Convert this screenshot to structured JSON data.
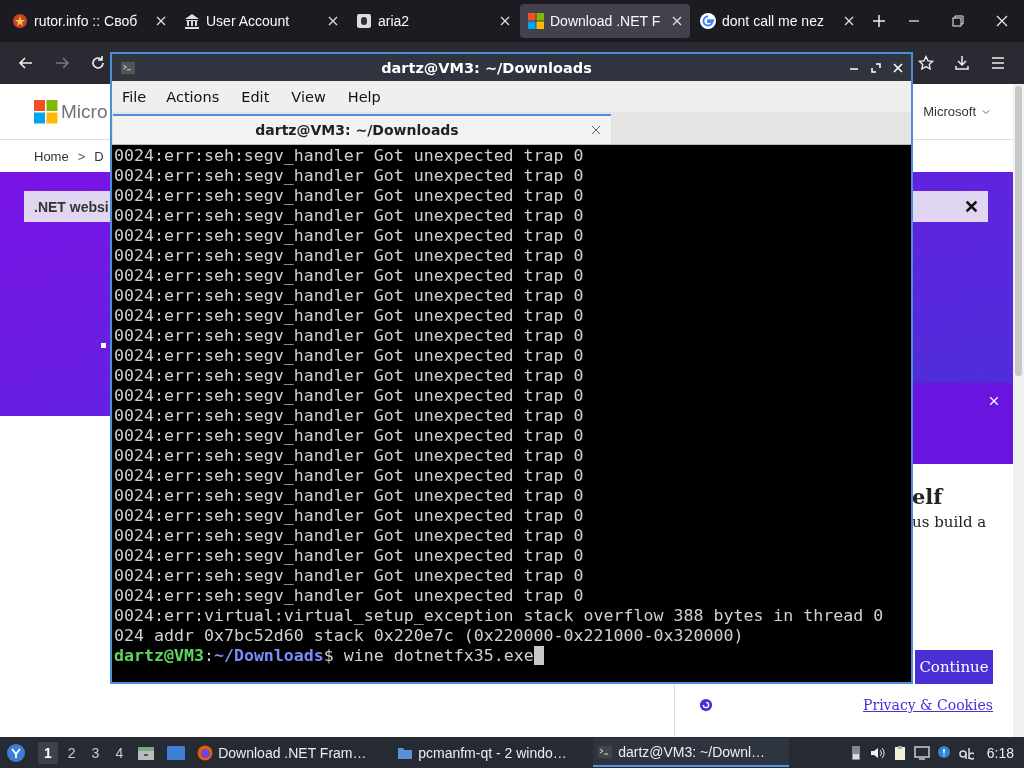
{
  "browser": {
    "tabs": [
      {
        "label": "rutor.info :: Своб",
        "selected": false
      },
      {
        "label": "User Account",
        "selected": false
      },
      {
        "label": "aria2",
        "selected": false
      },
      {
        "label": "Download .NET F",
        "selected": true
      },
      {
        "label": "dont call me nez",
        "selected": false
      }
    ],
    "page": {
      "logo_text": "Micro",
      "account": "Microsoft",
      "breadcrumb": [
        "Home",
        ">",
        "D"
      ],
      "notice": ".NET websi",
      "dialog": {
        "heading": "elf",
        "text": "us build a",
        "button": "Continue",
        "link": "Privacy & Cookies"
      }
    }
  },
  "terminal": {
    "title": "dartz@VM3: ~/Downloads",
    "menu": [
      "File",
      "Actions",
      "Edit",
      "View",
      "Help"
    ],
    "tab": "dartz@VM3: ~/Downloads",
    "lines": [
      "0024:err:seh:segv_handler Got unexpected trap 0",
      "0024:err:seh:segv_handler Got unexpected trap 0",
      "0024:err:seh:segv_handler Got unexpected trap 0",
      "0024:err:seh:segv_handler Got unexpected trap 0",
      "0024:err:seh:segv_handler Got unexpected trap 0",
      "0024:err:seh:segv_handler Got unexpected trap 0",
      "0024:err:seh:segv_handler Got unexpected trap 0",
      "0024:err:seh:segv_handler Got unexpected trap 0",
      "0024:err:seh:segv_handler Got unexpected trap 0",
      "0024:err:seh:segv_handler Got unexpected trap 0",
      "0024:err:seh:segv_handler Got unexpected trap 0",
      "0024:err:seh:segv_handler Got unexpected trap 0",
      "0024:err:seh:segv_handler Got unexpected trap 0",
      "0024:err:seh:segv_handler Got unexpected trap 0",
      "0024:err:seh:segv_handler Got unexpected trap 0",
      "0024:err:seh:segv_handler Got unexpected trap 0",
      "0024:err:seh:segv_handler Got unexpected trap 0",
      "0024:err:seh:segv_handler Got unexpected trap 0",
      "0024:err:seh:segv_handler Got unexpected trap 0",
      "0024:err:seh:segv_handler Got unexpected trap 0",
      "0024:err:seh:segv_handler Got unexpected trap 0",
      "0024:err:seh:segv_handler Got unexpected trap 0",
      "0024:err:seh:segv_handler Got unexpected trap 0",
      "0024:err:virtual:virtual_setup_exception stack overflow 388 bytes in thread 0",
      "024 addr 0x7bc52d60 stack 0x220e7c (0x220000-0x221000-0x320000)"
    ],
    "prompt": {
      "user": "dartz@VM3",
      "sep": ":",
      "path": "~/Downloads",
      "command": "$ wine dotnetfx35.exe"
    }
  },
  "taskbar": {
    "workspaces": [
      {
        "label": "1",
        "selected": true
      },
      {
        "label": "2",
        "selected": false
      },
      {
        "label": "3",
        "selected": false
      },
      {
        "label": "4",
        "selected": false
      }
    ],
    "tasks": [
      {
        "label": "Download .NET Fram…",
        "selected": false
      },
      {
        "label": "pcmanfm-qt - 2 windo…",
        "selected": false
      },
      {
        "label": "dartz@VM3: ~/Downl…",
        "selected": true
      }
    ],
    "clock": "6:18"
  }
}
